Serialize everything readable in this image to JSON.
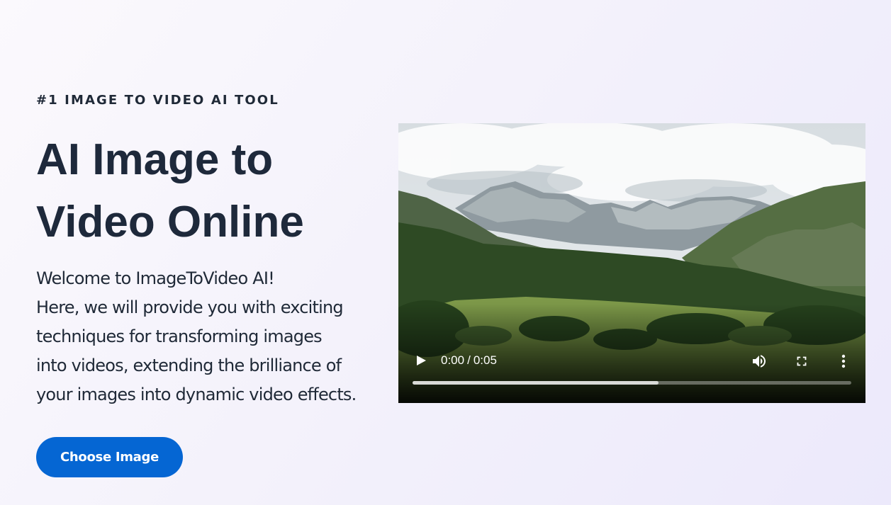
{
  "hero": {
    "eyebrow": "#1 IMAGE TO VIDEO AI TOOL",
    "title_lines": [
      "AI Image to",
      "Video Online"
    ],
    "description_lines": [
      "Welcome to ImageToVideo AI!",
      "Here, we will provide you with exciting",
      "techniques for transforming images",
      "into videos, extending the brilliance of",
      "your images into dynamic video effects."
    ],
    "cta_label": "Choose Image"
  },
  "video": {
    "current_time": "0:00",
    "separator": "/",
    "duration": "0:05",
    "buffered_fraction": 0.56,
    "icons": [
      "play-icon",
      "volume-icon",
      "fullscreen-icon",
      "more-options-icon"
    ]
  },
  "colors": {
    "title": "#1e293b",
    "cta_background": "#0566d3",
    "cta_text": "#ffffff"
  }
}
